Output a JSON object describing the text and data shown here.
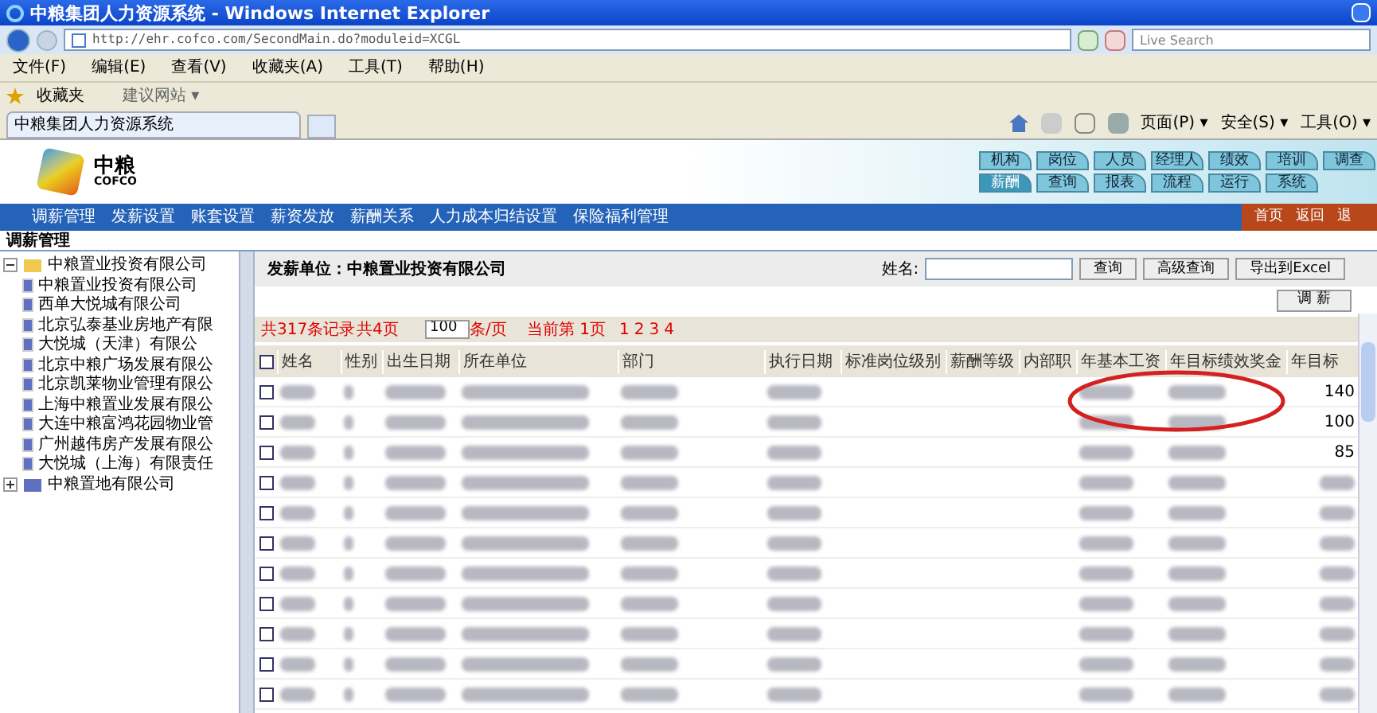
{
  "window": {
    "title": "中粮集团人力资源系统 - Windows Internet Explorer"
  },
  "address_bar": {
    "value": "http://ehr.cofco.com/SecondMain.do?moduleid=XCGL"
  },
  "search": {
    "placeholder": "Live Search"
  },
  "menu": [
    "文件(F)",
    "编辑(E)",
    "查看(V)",
    "收藏夹(A)",
    "工具(T)",
    "帮助(H)"
  ],
  "favorites_bar": {
    "favorites": "收藏夹",
    "suggested": "建议网站 ▾"
  },
  "browser_tab": {
    "title": "中粮集团人力资源系统"
  },
  "command_bar": [
    "页面(P) ▾",
    "安全(S) ▾",
    "工具(O) ▾"
  ],
  "logo": {
    "name": "中粮",
    "latin": "COFCO"
  },
  "module_tabs": [
    [
      {
        "label": "机构",
        "selected": false
      },
      {
        "label": "岗位",
        "selected": false
      },
      {
        "label": "人员",
        "selected": false
      },
      {
        "label": "经理人",
        "selected": false
      },
      {
        "label": "绩效",
        "selected": false
      },
      {
        "label": "培训",
        "selected": false
      },
      {
        "label": "调查",
        "selected": false
      }
    ],
    [
      {
        "label": "薪酬",
        "selected": true
      },
      {
        "label": "查询",
        "selected": false
      },
      {
        "label": "报表",
        "selected": false
      },
      {
        "label": "流程",
        "selected": false
      },
      {
        "label": "运行",
        "selected": false
      },
      {
        "label": "系统",
        "selected": false
      }
    ]
  ],
  "nav": [
    "调薪管理",
    "发薪设置",
    "账套设置",
    "薪资发放",
    "薪酬关系",
    "人力成本归结设置",
    "保险福利管理"
  ],
  "nav_links": [
    "首页",
    "返回",
    "退"
  ],
  "section_title": "调薪管理",
  "tree": [
    {
      "label": "中粮置业投资有限公司",
      "expanded": true,
      "children": [
        {
          "label": "中粮置业投资有限公司"
        },
        {
          "label": "西单大悦城有限公司"
        },
        {
          "label": "北京弘泰基业房地产有限"
        },
        {
          "label": "大悦城（天津）有限公"
        },
        {
          "label": "北京中粮广场发展有限公"
        },
        {
          "label": "北京凯莱物业管理有限公"
        },
        {
          "label": "上海中粮置业发展有限公"
        },
        {
          "label": "大连中粮富鸿花园物业管"
        },
        {
          "label": "广州越伟房产发展有限公"
        },
        {
          "label": "大悦城（上海）有限责任"
        }
      ]
    },
    {
      "label": "中粮置地有限公司",
      "expanded": false
    }
  ],
  "unit": "发薪单位：中粮置业投资有限公司",
  "name_search": {
    "label": "姓名:"
  },
  "buttons": [
    "查询",
    "高级查询",
    "导出到Excel"
  ],
  "adjust_button": "调 薪",
  "pagination": {
    "total": "共317条记录",
    "pages": "共4页",
    "page_size": "100",
    "per_page": "条/页",
    "current": "当前第 1页",
    "page_links": [
      "1",
      "2",
      "3",
      "4"
    ]
  },
  "table": {
    "select_all": {
      "checked": false
    },
    "columns": [
      "姓名",
      "性别",
      "出生日期",
      "所在单位",
      "部门",
      "执行日期",
      "标准岗位级别",
      "薪酬等级",
      "内部职",
      "年基本工资",
      "年目标绩效奖金",
      "年目标"
    ],
    "rows": [
      {
        "checked": false,
        "column_12": "140"
      },
      {
        "checked": false,
        "column_12": "100"
      },
      {
        "checked": false,
        "column_12": "85"
      },
      {
        "checked": false
      },
      {
        "checked": false
      },
      {
        "checked": false
      },
      {
        "checked": false
      },
      {
        "checked": false
      },
      {
        "checked": false
      },
      {
        "checked": false
      },
      {
        "checked": false
      }
    ]
  }
}
